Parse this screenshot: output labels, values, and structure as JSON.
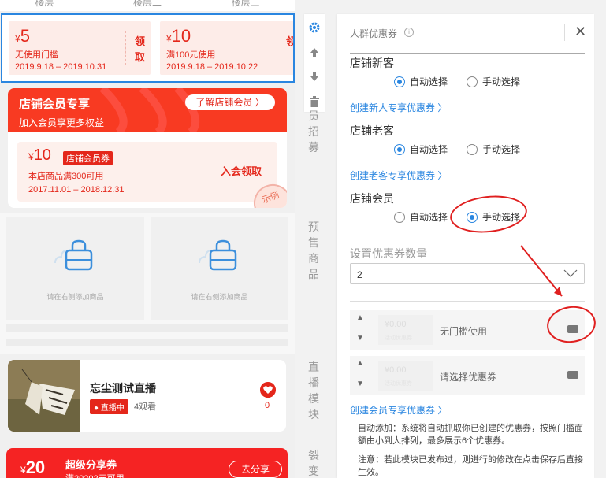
{
  "preview": {
    "floor_tabs": [
      "楼层一",
      "楼层二",
      "楼层三"
    ],
    "coupons": [
      {
        "yen": "¥",
        "amount": "5",
        "condition": "无使用门槛",
        "date": "2019.9.18 – 2019.10.31",
        "claim": "领取"
      },
      {
        "yen": "¥",
        "amount": "10",
        "condition": "满100元使用",
        "date": "2019.9.18 – 2019.10.22",
        "claim": "领"
      }
    ],
    "member": {
      "title": "店铺会员专享",
      "subtitle": "加入会员享更多权益",
      "button": "了解店铺会员 〉",
      "coupon_yen": "¥",
      "coupon_amount": "10",
      "coupon_tag": "店铺会员券",
      "coupon_condition": "本店商品满300可用",
      "coupon_date": "2017.11.01 – 2018.12.31",
      "join": "入会领取",
      "sample": "示例"
    },
    "products": [
      "请在右侧添加商品",
      "请在右侧添加商品"
    ],
    "live": {
      "title": "忘尘测试直播",
      "badge": "● 直播中",
      "watchers": "4观看",
      "likes": "0"
    },
    "share": {
      "yen": "¥",
      "amount": "20",
      "title": "超级分享券",
      "condition": "满20202元可用",
      "button": "去分享"
    }
  },
  "toolbar": {
    "icons": [
      "gear-icon",
      "arrow-up-icon",
      "arrow-down-icon",
      "trash-icon"
    ]
  },
  "sections": [
    {
      "label": "员招募"
    },
    {
      "label": "预售商品"
    },
    {
      "label": "直播模块"
    },
    {
      "label": "裂变"
    }
  ],
  "panel": {
    "title": "人群优惠券",
    "info": "i",
    "close": "✕",
    "groups": [
      {
        "title": "店铺新客",
        "options": [
          "自动选择",
          "手动选择"
        ],
        "selected": 0,
        "link": "创建新人专享优惠券 〉"
      },
      {
        "title": "店铺老客",
        "options": [
          "自动选择",
          "手动选择"
        ],
        "selected": 0,
        "link": "创建老客专享优惠券 〉"
      },
      {
        "title": "店铺会员",
        "options": [
          "自动选择",
          "手动选择"
        ],
        "selected": 1,
        "link": "创建会员专享优惠券 〉"
      }
    ],
    "count_label": "设置优惠券数量",
    "count_value": "2",
    "slots": [
      {
        "value": "¥0.00",
        "sub": "活动优惠券",
        "desc": "无门槛使用"
      },
      {
        "value": "¥0.00",
        "sub": "活动优惠券",
        "desc": "请选择优惠券"
      }
    ],
    "notes": [
      "自动添加：系统将自动抓取你已创建的优惠券，按照门槛面额由小到大排列，最多展示6个优惠券。",
      "注意：若此模块已发布过，则进行的修改在点击保存后直接生效。"
    ]
  },
  "colors": {
    "accent_blue": "#2a86e0",
    "brand_red": "#e4271b",
    "annotation_red": "#e02020"
  }
}
